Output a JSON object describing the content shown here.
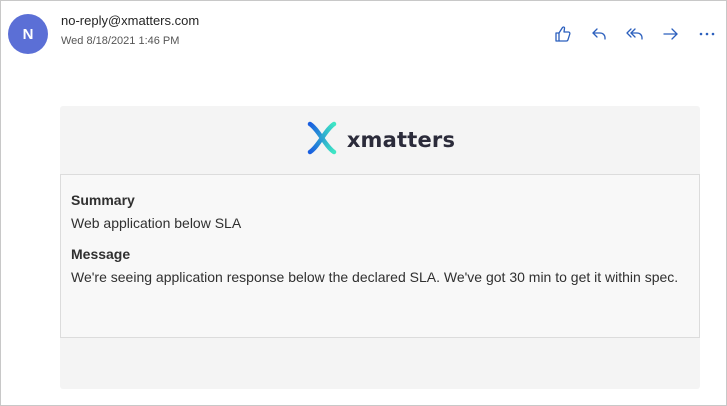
{
  "header": {
    "avatar_initial": "N",
    "sender": "no-reply@xmatters.com",
    "date": "Wed 8/18/2021 1:46 PM"
  },
  "actions": [
    {
      "name": "like",
      "icon": "thumbs-up-icon"
    },
    {
      "name": "reply",
      "icon": "reply-icon"
    },
    {
      "name": "reply-all",
      "icon": "reply-all-icon"
    },
    {
      "name": "forward",
      "icon": "forward-icon"
    },
    {
      "name": "more",
      "icon": "more-icon"
    }
  ],
  "card": {
    "brand": "xmatters",
    "summary_label": "Summary",
    "summary_value": "Web application below SLA",
    "message_label": "Message",
    "message_value": "We're seeing application response below the declared SLA. We've got 30 min to get it within spec."
  },
  "colors": {
    "avatar": "#5b6fd6",
    "action_icon": "#2b5fbd",
    "logo_gradient_start": "#1a5fe0",
    "logo_gradient_end": "#3ee6c4"
  }
}
